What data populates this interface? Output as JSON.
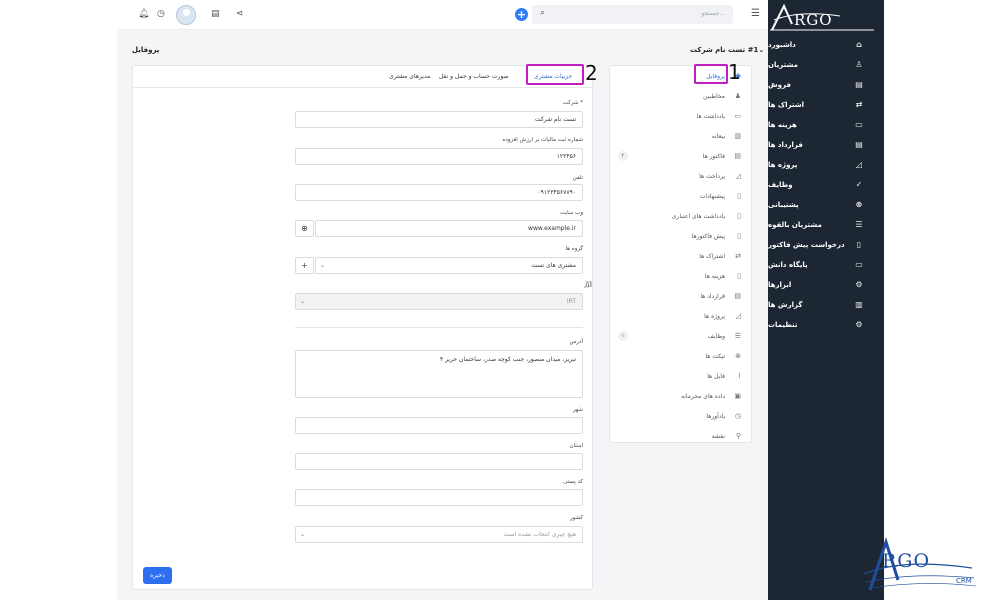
{
  "logo": {
    "text": "RGO",
    "text_bottom": "RGO",
    "crm": "CRM"
  },
  "topbar": {
    "search_placeholder": "جستجو...",
    "plus_label": "+"
  },
  "sidebar": {
    "items": [
      {
        "label": "داشبورد",
        "icon": "home-icon",
        "glyph": "⌂",
        "chev": ""
      },
      {
        "label": "مشتریان",
        "icon": "user-icon",
        "glyph": "♙",
        "chev": ""
      },
      {
        "label": "فروش",
        "icon": "receipt-icon",
        "glyph": "▤",
        "chev": "‹"
      },
      {
        "label": "اشتراک ها",
        "icon": "sync-icon",
        "glyph": "⇄",
        "chev": ""
      },
      {
        "label": "هزینه ها",
        "icon": "document-icon",
        "glyph": "▭",
        "chev": ""
      },
      {
        "label": "قرارداد ها",
        "icon": "file-icon",
        "glyph": "▤",
        "chev": ""
      },
      {
        "label": "پروژه ها",
        "icon": "chart-icon",
        "glyph": "◿",
        "chev": ""
      },
      {
        "label": "وظایف",
        "icon": "check-circle-icon",
        "glyph": "✓",
        "chev": ""
      },
      {
        "label": "پشتیبانی",
        "icon": "lifebuoy-icon",
        "glyph": "⊗",
        "chev": ""
      },
      {
        "label": "مشتریان بالقوه",
        "icon": "leads-icon",
        "glyph": "☰",
        "chev": ""
      },
      {
        "label": "درخواست پیش فاکتور",
        "icon": "file-outline-icon",
        "glyph": "▯",
        "chev": ""
      },
      {
        "label": "پایگاه دانش",
        "icon": "folder-icon",
        "glyph": "▭",
        "chev": ""
      },
      {
        "label": "ابزارها",
        "icon": "tools-icon",
        "glyph": "⚙",
        "chev": "‹"
      },
      {
        "label": "گزارش ها",
        "icon": "report-icon",
        "glyph": "▥",
        "chev": "‹"
      },
      {
        "label": "تنظیمات",
        "icon": "gear-icon",
        "glyph": "⚙",
        "chev": ""
      }
    ]
  },
  "header": {
    "page_title": "پروفایل",
    "company_name": "#1 تست نام شرکت"
  },
  "nav": {
    "items": [
      {
        "label": "پروفایل",
        "icon": "user-circle-icon",
        "glyph": "◉",
        "badge": ""
      },
      {
        "label": "مخاطبین",
        "icon": "user-icon",
        "glyph": "♟",
        "badge": ""
      },
      {
        "label": "یادداشت ها",
        "icon": "note-icon",
        "glyph": "▭",
        "badge": ""
      },
      {
        "label": "بیعانه",
        "icon": "chart-bar-icon",
        "glyph": "▥",
        "badge": ""
      },
      {
        "label": "فاکتور ها",
        "icon": "invoice-icon",
        "glyph": "▤",
        "badge": "۲"
      },
      {
        "label": "پرداخت ها",
        "icon": "payment-icon",
        "glyph": "◿",
        "badge": ""
      },
      {
        "label": "پیشنهادات",
        "icon": "proposal-icon",
        "glyph": "▯",
        "badge": ""
      },
      {
        "label": "یادداشت های اعتباری",
        "icon": "credit-note-icon",
        "glyph": "▯",
        "badge": ""
      },
      {
        "label": "پیش فاکتورها",
        "icon": "estimate-icon",
        "glyph": "▯",
        "badge": ""
      },
      {
        "label": "اشتراک ها",
        "icon": "sync-icon",
        "glyph": "⇄",
        "badge": ""
      },
      {
        "label": "هزینه ها",
        "icon": "expense-icon",
        "glyph": "▯",
        "badge": ""
      },
      {
        "label": "قرارداد ها",
        "icon": "contract-icon",
        "glyph": "▤",
        "badge": ""
      },
      {
        "label": "پروژه ها",
        "icon": "project-icon",
        "glyph": "◿",
        "badge": ""
      },
      {
        "label": "وظایف",
        "icon": "tasks-icon",
        "glyph": "☰",
        "badge": "۱"
      },
      {
        "label": "تیکت ها",
        "icon": "ticket-icon",
        "glyph": "⊗",
        "badge": ""
      },
      {
        "label": "فایل ها",
        "icon": "paperclip-icon",
        "glyph": "⌇",
        "badge": ""
      },
      {
        "label": "داده های محرمانه",
        "icon": "lock-icon",
        "glyph": "▣",
        "badge": ""
      },
      {
        "label": "یادآورها",
        "icon": "clock-icon",
        "glyph": "◷",
        "badge": ""
      },
      {
        "label": "نقشه",
        "icon": "map-pin-icon",
        "glyph": "⚲",
        "badge": ""
      }
    ]
  },
  "tabs": {
    "details": "جزییات مشتری",
    "billing": "صورت حساب و حمل و نقل",
    "admins": "مدیرهای مشتری"
  },
  "annotations": {
    "n1": "1",
    "n2": "2"
  },
  "form": {
    "company_label": "* شرکت",
    "company_value": "تست نام شرکت",
    "vat_label": "شماره ثبت مالیات بر ارزش افزوده",
    "vat_value": "۱۲۳۴۵۶",
    "phone_label": "تلفن",
    "phone_value": "۰۹۱۲۳۴۵۶۷۸۹۰",
    "website_label": "وب سایت",
    "website_value": "www.example.ir",
    "groups_label": "گروه ها",
    "groups_value": "مشتری های تست",
    "currency_label": "ارز",
    "currency_value": "IRT",
    "address_label": "آدرس",
    "address_value": "تبریز، میدان منصور، جنب  کوچه صدر، ساختمان حریر ۴",
    "city_label": "شهر",
    "state_label": "استان",
    "zip_label": "کد پستی",
    "country_label": "کشور",
    "country_placeholder": "هیچ چیزی انتخاب نشده است",
    "save_label": "ذخیره"
  }
}
